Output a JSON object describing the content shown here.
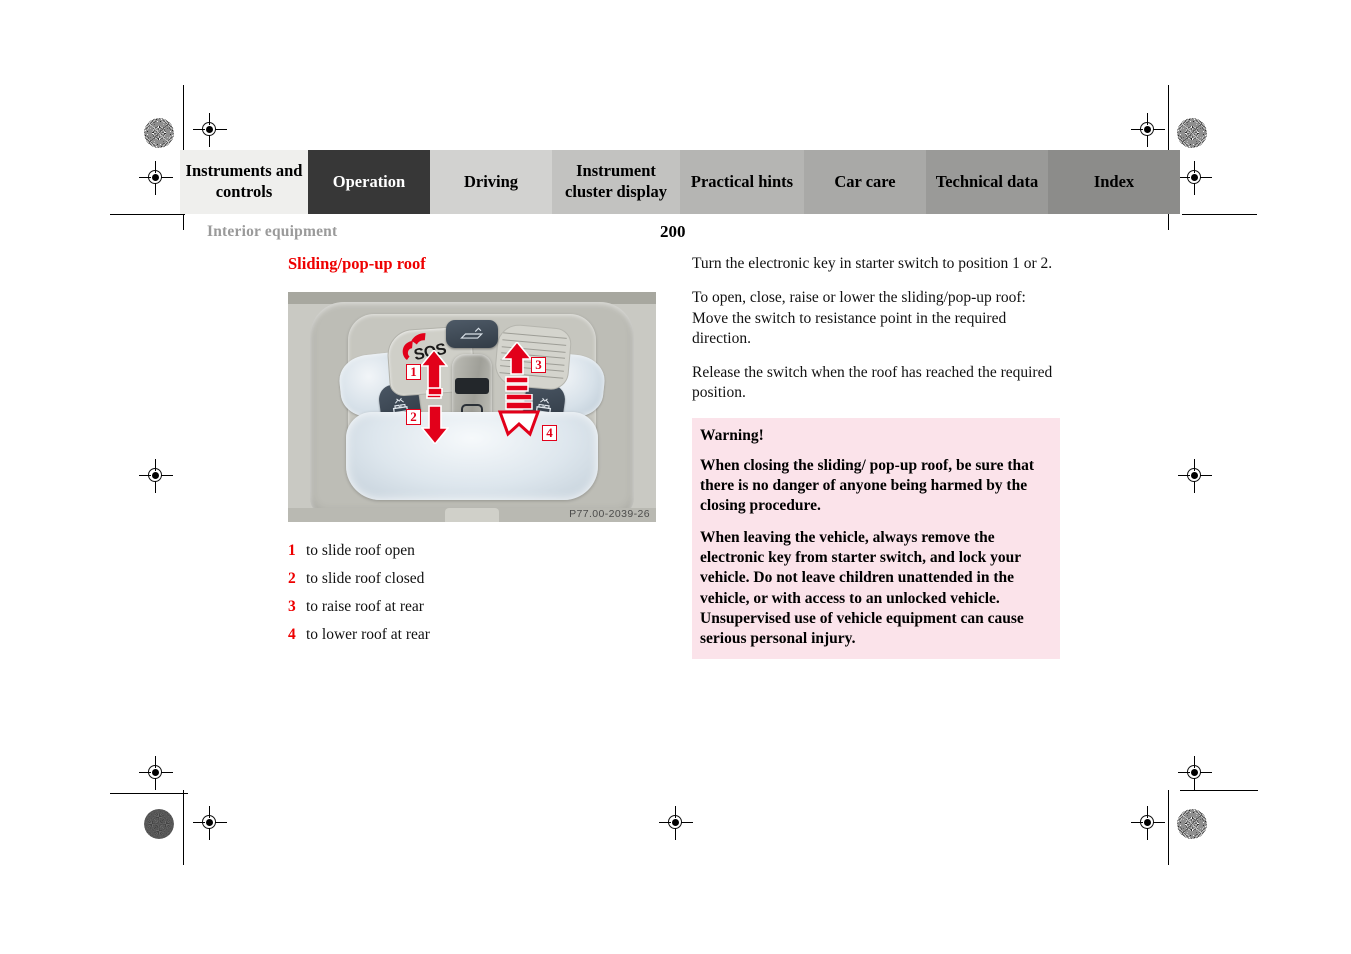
{
  "nav": {
    "tabs": [
      {
        "label": "Instruments and controls",
        "active": false,
        "bg": "#efefed"
      },
      {
        "label": "Operation",
        "active": true,
        "bg": "#373737"
      },
      {
        "label": "Driving",
        "active": false,
        "bg": "#d2d2d0"
      },
      {
        "label": "Instrument cluster display",
        "active": false,
        "bg": "#c2c2c0"
      },
      {
        "label": "Practical hints",
        "active": false,
        "bg": "#b5b5b3"
      },
      {
        "label": "Car care",
        "active": false,
        "bg": "#a9a9a7"
      },
      {
        "label": "Technical data",
        "active": false,
        "bg": "#9a9a98"
      },
      {
        "label": "Index",
        "active": false,
        "bg": "#8c8c8a"
      }
    ]
  },
  "header": {
    "running_head": "Interior equipment",
    "page_number": "200"
  },
  "left": {
    "section_title": "Sliding/pop-up roof",
    "figure": {
      "code": "P77.00-2039-26",
      "sos_label": "SOS",
      "callouts": [
        "1",
        "2",
        "3",
        "4"
      ]
    },
    "legend": [
      {
        "num": "1",
        "text": "to slide roof open"
      },
      {
        "num": "2",
        "text": "to slide roof closed"
      },
      {
        "num": "3",
        "text": "to raise roof at rear"
      },
      {
        "num": "4",
        "text": "to lower roof at rear"
      }
    ]
  },
  "right": {
    "paragraphs": [
      "Turn the electronic key in starter switch to position 1 or 2.",
      "To open, close, raise or lower the sliding/pop-up roof: Move the switch to resistance point in the required direction.",
      "Release the switch when the roof has reached the required position."
    ],
    "warning": {
      "title": "Warning!",
      "body": [
        "When closing the sliding/ pop-up roof, be sure that there is no danger of anyone being harmed by the closing procedure.",
        "When leaving the vehicle, always remove the electronic key from starter switch, and lock your vehicle. Do not leave children unattended in the vehicle, or with access to an unlocked vehicle. Unsupervised use of vehicle equipment can cause serious personal injury."
      ],
      "bg": "#fbe3ea"
    }
  },
  "colors": {
    "accent_red": "#ee0000",
    "arrow_red": "#e2001a",
    "running_head_gray": "#9a9a9a"
  }
}
